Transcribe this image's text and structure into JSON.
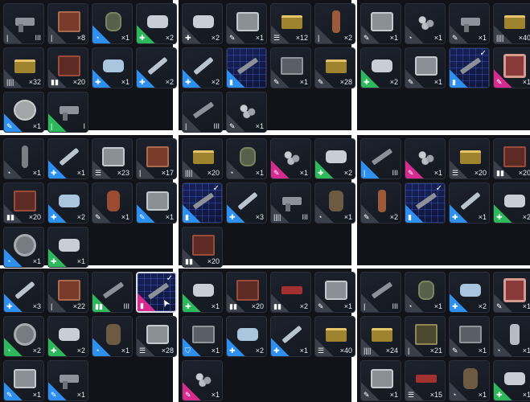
{
  "panels": [
    {
      "items": [
        {
          "icon": "pistol",
          "rarity": "gray",
          "type": "|",
          "qty": "III",
          "art": "pistol"
        },
        {
          "icon": "crate",
          "rarity": "gray",
          "type": "|",
          "qty": "×8",
          "art": "crate"
        },
        {
          "icon": "grenade",
          "rarity": "blue",
          "type": "◔",
          "qty": "×1",
          "art": "grenade"
        },
        {
          "icon": "tape",
          "rarity": "green",
          "type": "✚",
          "qty": "×2",
          "art": "tape"
        },
        {
          "icon": "ammo",
          "rarity": "gray",
          "type": "||||",
          "qty": "×32",
          "art": "ammo"
        },
        {
          "icon": "crate",
          "rarity": "gray",
          "type": "▮▮",
          "qty": "×20",
          "art": "crate red"
        },
        {
          "icon": "tape",
          "rarity": "blue",
          "type": "✚",
          "qty": "×1",
          "art": "tape blue"
        },
        {
          "icon": "injector",
          "rarity": "blue",
          "type": "✚",
          "qty": "×2",
          "art": "inj"
        },
        {
          "icon": "disc",
          "rarity": "blue",
          "type": "✎",
          "qty": "×1",
          "art": "disc"
        },
        {
          "icon": "pistol",
          "rarity": "green",
          "type": "|",
          "qty": "I",
          "art": "pistol"
        }
      ]
    },
    {
      "items": [
        {
          "icon": "tape",
          "rarity": "gray",
          "type": "✚",
          "qty": "×2",
          "art": "tape"
        },
        {
          "icon": "case",
          "rarity": "gray",
          "type": "✎",
          "qty": "×1",
          "art": "case"
        },
        {
          "icon": "ammo",
          "rarity": "gray",
          "type": "☰",
          "qty": "×12",
          "art": "ammo"
        },
        {
          "icon": "knife",
          "rarity": "gray",
          "type": "|",
          "qty": "×2",
          "art": "knife"
        },
        {
          "icon": "rifle",
          "rarity": "blue",
          "type": "✚",
          "qty": "×2",
          "art": "inj"
        },
        {
          "icon": "rifle",
          "rarity": "blue",
          "type": "▮",
          "qty": "",
          "art": "rifle",
          "blueprint": true
        },
        {
          "icon": "tray",
          "rarity": "gray",
          "type": "✎",
          "qty": "×1",
          "art": "tray"
        },
        {
          "icon": "ammo",
          "rarity": "gray",
          "type": "✎",
          "qty": "×28",
          "art": "ammo"
        },
        {
          "icon": "rifle",
          "rarity": "gray",
          "type": "|",
          "qty": "III",
          "art": "rifle"
        },
        {
          "icon": "parts",
          "rarity": "gray",
          "type": "✎",
          "qty": "×1",
          "art": "parts"
        }
      ]
    },
    {
      "items": [
        {
          "icon": "case",
          "rarity": "gray",
          "type": "✎",
          "qty": "×1",
          "art": "case"
        },
        {
          "icon": "parts",
          "rarity": "gray",
          "type": "◔",
          "qty": "×1",
          "art": "parts"
        },
        {
          "icon": "pistol",
          "rarity": "gray",
          "type": "✎",
          "qty": "×1",
          "art": "pistol"
        },
        {
          "icon": "ammo",
          "rarity": "gray",
          "type": "||||",
          "qty": "×40",
          "art": "ammo"
        },
        {
          "icon": "tape",
          "rarity": "green",
          "type": "✚",
          "qty": "×2",
          "art": "tape"
        },
        {
          "icon": "case",
          "rarity": "gray",
          "type": "✎",
          "qty": "×1",
          "art": "case"
        },
        {
          "icon": "rifle",
          "rarity": "blue",
          "type": "▮",
          "qty": "",
          "art": "rifle",
          "blueprint": true,
          "check": true
        },
        {
          "icon": "bomb",
          "rarity": "pink",
          "type": "✎",
          "qty": "×1",
          "art": "bomb"
        }
      ]
    },
    {
      "items": [
        {
          "icon": "tube",
          "rarity": "gray",
          "type": "◔",
          "qty": "×1",
          "art": "tube"
        },
        {
          "icon": "injector",
          "rarity": "blue",
          "type": "✚",
          "qty": "×1",
          "art": "inj"
        },
        {
          "icon": "case",
          "rarity": "gray",
          "type": "☰",
          "qty": "×23",
          "art": "case"
        },
        {
          "icon": "crate",
          "rarity": "gray",
          "type": "|",
          "qty": "×17",
          "art": "crate"
        },
        {
          "icon": "crate",
          "rarity": "gray",
          "type": "▮▮",
          "qty": "×20",
          "art": "crate red"
        },
        {
          "icon": "tape",
          "rarity": "blue",
          "type": "✚",
          "qty": "×2",
          "art": "tape blue"
        },
        {
          "icon": "canister",
          "rarity": "gray",
          "type": "✎",
          "qty": "×1",
          "art": "canister"
        },
        {
          "icon": "case",
          "rarity": "blue",
          "type": "✎",
          "qty": "×1",
          "art": "case"
        },
        {
          "icon": "wheel",
          "rarity": "blue",
          "type": "◔",
          "qty": "×1",
          "art": "wheel"
        },
        {
          "icon": "tape",
          "rarity": "green",
          "type": "✚",
          "qty": "×1",
          "art": "tape"
        }
      ]
    },
    {
      "items": [
        {
          "icon": "ammo",
          "rarity": "gray",
          "type": "||||",
          "qty": "×20",
          "art": "ammo"
        },
        {
          "icon": "grenade",
          "rarity": "gray",
          "type": "◔",
          "qty": "×1",
          "art": "grenade"
        },
        {
          "icon": "parts",
          "rarity": "pink",
          "type": "✎",
          "qty": "×1",
          "art": "parts"
        },
        {
          "icon": "tape",
          "rarity": "green",
          "type": "✚",
          "qty": "×2",
          "art": "tape"
        },
        {
          "icon": "rifle",
          "rarity": "blue",
          "type": "▮",
          "qty": "",
          "art": "rifle",
          "blueprint": true,
          "check": true
        },
        {
          "icon": "injector",
          "rarity": "blue",
          "type": "✚",
          "qty": "×3",
          "art": "inj"
        },
        {
          "icon": "pistol",
          "rarity": "gray",
          "type": "||||",
          "qty": "III",
          "art": "pistol"
        },
        {
          "icon": "sack",
          "rarity": "gray",
          "type": "◔",
          "qty": "×1",
          "art": "sack"
        },
        {
          "icon": "crate",
          "rarity": "gray",
          "type": "▮▮",
          "qty": "×20",
          "art": "crate red"
        }
      ]
    },
    {
      "items": [
        {
          "icon": "rifle",
          "rarity": "blue",
          "type": "|",
          "qty": "III",
          "art": "rifle"
        },
        {
          "icon": "parts",
          "rarity": "pink",
          "type": "✎",
          "qty": "×1",
          "art": "parts"
        },
        {
          "icon": "ammo",
          "rarity": "gray",
          "type": "☰",
          "qty": "×20",
          "art": "ammo"
        },
        {
          "icon": "crate",
          "rarity": "gray",
          "type": "▮▮",
          "qty": "×20",
          "art": "crate red"
        },
        {
          "icon": "knife",
          "rarity": "gray",
          "type": "✎",
          "qty": "×2",
          "art": "knife"
        },
        {
          "icon": "rifle",
          "rarity": "blue",
          "type": "▮",
          "qty": "",
          "art": "rifle",
          "blueprint": true,
          "check": true
        },
        {
          "icon": "injector",
          "rarity": "blue",
          "type": "✚",
          "qty": "×1",
          "art": "inj"
        },
        {
          "icon": "tape",
          "rarity": "green",
          "type": "✚",
          "qty": "×2",
          "art": "tape"
        }
      ]
    },
    {
      "items": [
        {
          "icon": "injector",
          "rarity": "blue",
          "type": "✚",
          "qty": "×3",
          "art": "inj"
        },
        {
          "icon": "crate",
          "rarity": "gray",
          "type": "|",
          "qty": "×22",
          "art": "crate"
        },
        {
          "icon": "rifle",
          "rarity": "green",
          "type": "▮▮",
          "qty": "III",
          "art": "rifle"
        },
        {
          "icon": "rifle",
          "rarity": "pink",
          "type": "▮",
          "qty": "",
          "art": "rifle",
          "blueprint": true,
          "check": true,
          "selected": true,
          "cursor": true
        },
        {
          "icon": "wheel",
          "rarity": "green",
          "type": "◔",
          "qty": "×2",
          "art": "wheel"
        },
        {
          "icon": "tape",
          "rarity": "green",
          "type": "✚",
          "qty": "×2",
          "art": "tape"
        },
        {
          "icon": "sack",
          "rarity": "blue",
          "type": "◔",
          "qty": "×1",
          "art": "sack"
        },
        {
          "icon": "case",
          "rarity": "gray",
          "type": "☰",
          "qty": "×28",
          "art": "case"
        },
        {
          "icon": "case",
          "rarity": "blue",
          "type": "✎",
          "qty": "×1",
          "art": "case"
        },
        {
          "icon": "pistol",
          "rarity": "blue",
          "type": "✎",
          "qty": "×1",
          "art": "pistol"
        }
      ]
    },
    {
      "items": [
        {
          "icon": "tape",
          "rarity": "green",
          "type": "✚",
          "qty": "×1",
          "art": "tape"
        },
        {
          "icon": "crate",
          "rarity": "gray",
          "type": "▮▮",
          "qty": "×20",
          "art": "crate red"
        },
        {
          "icon": "shell",
          "rarity": "gray",
          "type": "▮▮",
          "qty": "×2",
          "art": "shell"
        },
        {
          "icon": "case",
          "rarity": "gray",
          "type": "✎",
          "qty": "×1",
          "art": "case"
        },
        {
          "icon": "tray",
          "rarity": "blue",
          "type": "⛉",
          "qty": "×1",
          "art": "tray"
        },
        {
          "icon": "tape",
          "rarity": "blue",
          "type": "✚",
          "qty": "×2",
          "art": "tape blue"
        },
        {
          "icon": "injector",
          "rarity": "blue",
          "type": "✚",
          "qty": "×1",
          "art": "inj"
        },
        {
          "icon": "ammo",
          "rarity": "gray",
          "type": "☰",
          "qty": "×40",
          "art": "ammo"
        },
        {
          "icon": "parts",
          "rarity": "pink",
          "type": "✎",
          "qty": "×1",
          "art": "parts"
        }
      ]
    },
    {
      "items": [
        {
          "icon": "rifle",
          "rarity": "gray",
          "type": "|",
          "qty": "III",
          "art": "rifle"
        },
        {
          "icon": "grenade",
          "rarity": "gray",
          "type": "◔",
          "qty": "×1",
          "art": "grenade"
        },
        {
          "icon": "tape",
          "rarity": "blue",
          "type": "✚",
          "qty": "×2",
          "art": "tape blue"
        },
        {
          "icon": "bomb",
          "rarity": "gray",
          "type": "✎",
          "qty": "×1",
          "art": "bomb"
        },
        {
          "icon": "ammo",
          "rarity": "gray",
          "type": "||||",
          "qty": "×24",
          "art": "ammo"
        },
        {
          "icon": "crate",
          "rarity": "gray",
          "type": "|",
          "qty": "×21",
          "art": "crate green"
        },
        {
          "icon": "tray",
          "rarity": "gray",
          "type": "✎",
          "qty": "×1",
          "art": "tray"
        },
        {
          "icon": "bottle",
          "rarity": "gray",
          "type": "◔",
          "qty": "×1",
          "art": "bottle"
        },
        {
          "icon": "case",
          "rarity": "gray",
          "type": "✎",
          "qty": "×1",
          "art": "case"
        },
        {
          "icon": "shell",
          "rarity": "gray",
          "type": "☰",
          "qty": "×15",
          "art": "shell"
        },
        {
          "icon": "sack",
          "rarity": "gray",
          "type": "◔",
          "qty": "×1",
          "art": "sack"
        },
        {
          "icon": "tape",
          "rarity": "green",
          "type": "✚",
          "qty": "×1",
          "art": "tape"
        }
      ]
    }
  ]
}
